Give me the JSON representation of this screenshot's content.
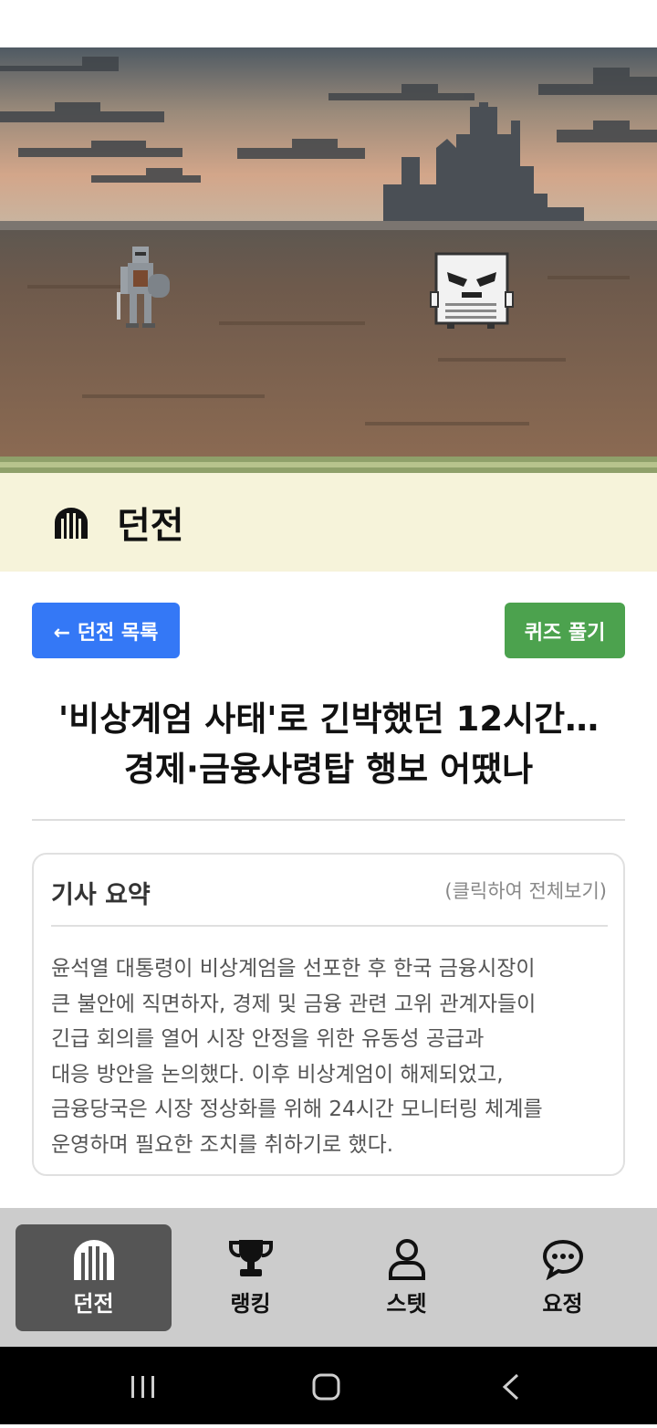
{
  "header": {
    "title": "던전"
  },
  "actions": {
    "back_label": "← 던전 목록",
    "quiz_label": "퀴즈 풀기"
  },
  "article": {
    "headline_line1": "'비상계엄 사태'로 긴박했던 12시간…",
    "headline_line2": "경제·금융사령탑 행보 어땠나",
    "summary_title": "기사 요약",
    "summary_hint": "(클릭하여 전체보기)",
    "summary_lines": [
      "윤석열 대통령이 비상계엄을 선포한 후 한국 금융시장이",
      "큰 불안에 직면하자, 경제 및 금융 관련 고위 관계자들이",
      "긴급 회의를 열어 시장 안정을 위한 유동성 공급과",
      "대응 방안을 논의했다. 이후 비상계엄이 해제되었고,",
      "금융당국은 시장 정상화를 위해 24시간 모니터링 체계를",
      "운영하며 필요한 조치를 취하기로 했다."
    ]
  },
  "nav": {
    "items": [
      {
        "label": "던전",
        "icon": "dungeon-gate-icon",
        "active": true
      },
      {
        "label": "랭킹",
        "icon": "trophy-icon",
        "active": false
      },
      {
        "label": "스텟",
        "icon": "user-icon",
        "active": false
      },
      {
        "label": "요정",
        "icon": "chat-bubble-icon",
        "active": false
      }
    ]
  },
  "colors": {
    "back_button": "#3478f6",
    "quiz_button": "#4ca24e",
    "header_bg": "#f6f3da",
    "nav_bg": "#cccccc",
    "nav_active": "#555555"
  }
}
